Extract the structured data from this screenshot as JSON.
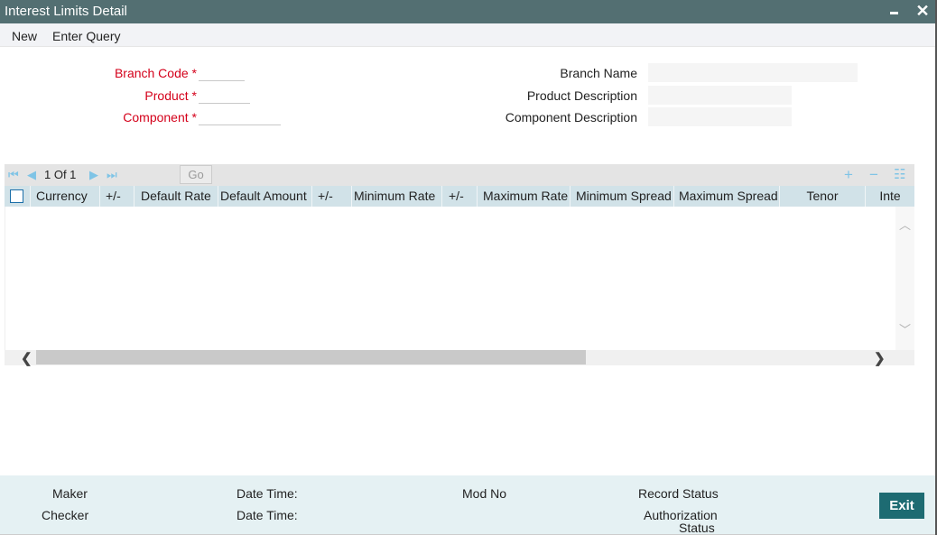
{
  "window": {
    "title": "Interest Limits Detail",
    "minimize_icon": "minimize-icon",
    "close_icon": "close-icon",
    "close_glyph": "✕"
  },
  "menu": {
    "items": [
      {
        "label": "New"
      },
      {
        "label": "Enter Query"
      }
    ]
  },
  "form": {
    "left": [
      {
        "label": "Branch Code",
        "required_mark": "*",
        "value": ""
      },
      {
        "label": "Product",
        "required_mark": "*",
        "value": ""
      },
      {
        "label": "Component",
        "required_mark": "*",
        "value": ""
      }
    ],
    "right": [
      {
        "label": "Branch Name",
        "value": ""
      },
      {
        "label": "Product Description",
        "value": ""
      },
      {
        "label": "Component Description",
        "value": ""
      }
    ]
  },
  "grid": {
    "toolbar": {
      "first_glyph": "⏮",
      "prev_glyph": "◀",
      "next_glyph": "▶",
      "last_glyph": "⏭",
      "page_info": "1 Of 1",
      "go_label": "Go",
      "add_glyph": "+",
      "remove_glyph": "−",
      "view_glyph": "☷"
    },
    "columns": [
      "Currency",
      "+/-",
      "Default Rate",
      "Default Amount",
      "+/-",
      "Minimum Rate",
      "+/-",
      "Maximum Rate",
      "Minimum Spread",
      "Maximum Spread",
      "Tenor",
      "Inte"
    ],
    "rows": [],
    "scroll": {
      "up_glyph": "︿",
      "down_glyph": "﹀",
      "left_glyph": "❮",
      "right_glyph": "❯"
    }
  },
  "footer": {
    "maker_label": "Maker",
    "checker_label": "Checker",
    "maker_datetime_label": "Date Time:",
    "checker_datetime_label": "Date Time:",
    "mod_no_label": "Mod No",
    "record_status_label": "Record Status",
    "auth_status_label_1": "Authorization",
    "auth_status_label_2": "Status",
    "exit_label": "Exit"
  }
}
